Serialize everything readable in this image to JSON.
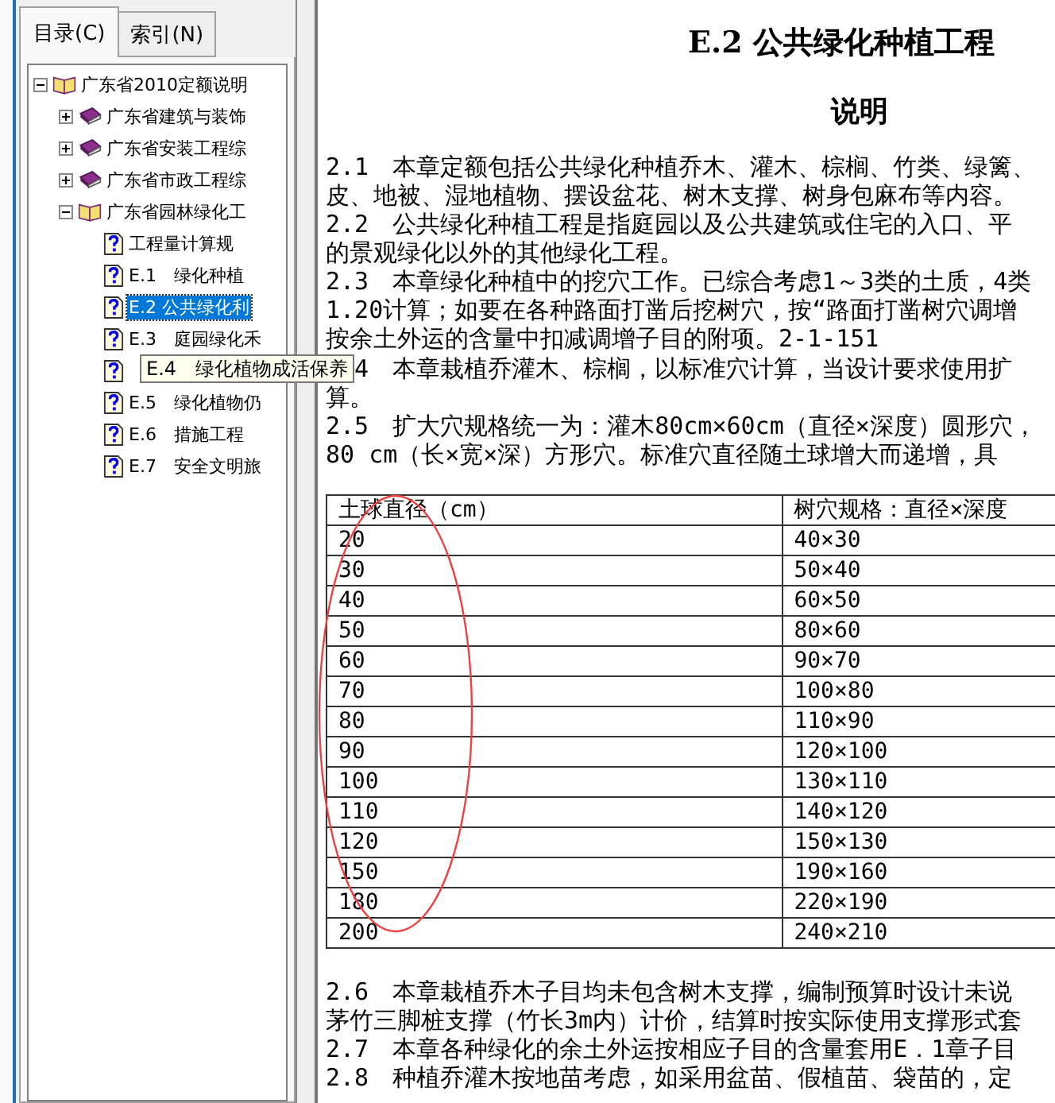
{
  "tabs": [
    {
      "label": "目录(C)",
      "selected": true
    },
    {
      "label": "索引(N)",
      "selected": false
    }
  ],
  "tree": [
    {
      "label": "广东省2010定额说明",
      "kind": "open-book",
      "expanded": true,
      "selected": false,
      "children": [
        {
          "label": "广东省建筑与装饰",
          "kind": "book",
          "expanded": false,
          "selected": false
        },
        {
          "label": "广东省安装工程综",
          "kind": "book",
          "expanded": false,
          "selected": false
        },
        {
          "label": "广东省市政工程综",
          "kind": "book",
          "expanded": false,
          "selected": false
        },
        {
          "label": "广东省园林绿化工",
          "kind": "open-book",
          "expanded": true,
          "selected": false,
          "children": [
            {
              "label": "工程量计算规",
              "kind": "page",
              "selected": false
            },
            {
              "label": "E.1　绿化种植",
              "kind": "page",
              "selected": false
            },
            {
              "label": "E.2 公共绿化利",
              "kind": "page",
              "selected": true
            },
            {
              "label": "E.3　庭园绿化禾",
              "kind": "page",
              "selected": false
            },
            {
              "kind": "page",
              "selected": false
            },
            {
              "label": "E.5　绿化植物仍",
              "kind": "page",
              "selected": false
            },
            {
              "label": "E.6　措施工程",
              "kind": "page",
              "selected": false
            },
            {
              "label": "E.7　安全文明旅",
              "kind": "page",
              "selected": false
            }
          ]
        }
      ]
    }
  ],
  "tooltip": "E.4　绿化植物成活保养",
  "document": {
    "title": "E.2 公共绿化种植工程",
    "subtitle": "说明",
    "lines_before": [
      {
        "kind": "line",
        "text": "2.1　本章定额包括公共绿化种植乔木、灌木、棕榈、竹类、绿篱、"
      },
      {
        "kind": "line",
        "text": "皮、地被、湿地植物、摆设盆花、树木支撑、树身包麻布等内容。"
      },
      {
        "kind": "line",
        "text": "2.2　公共绿化种植工程是指庭园以及公共建筑或住宅的入口、平"
      },
      {
        "kind": "line",
        "text": "的景观绿化以外的其他绿化工程。"
      },
      {
        "kind": "line",
        "text": "2.3　本章绿化种植中的挖穴工作。已综合考虑1～3类的土质，4类"
      },
      {
        "kind": "line",
        "text": "1.20计算；如要在各种路面打凿后挖树穴，按“路面打凿树穴调增"
      },
      {
        "kind": "line",
        "text": "按余土外运的含量中扣减调增子目的附项。2-1-151"
      },
      {
        "kind": "covered",
        "text": "4　本章栽植乔灌木、棕榈，以标准穴计算，当设计要求使用扩"
      },
      {
        "kind": "line",
        "text": "算。"
      },
      {
        "kind": "line",
        "text": "2.5　扩大穴规格统一为：灌木80cm×60cm（直径×深度）圆形穴，"
      },
      {
        "kind": "line",
        "text": "80 cm（长×宽×深）方形穴。标准穴直径随土球增大而递增，具"
      }
    ],
    "table": {
      "columns": [
        "土球直径（cm）",
        "树穴规格：直径×深度"
      ],
      "rows": [
        [
          "20",
          "40×30"
        ],
        [
          "30",
          "50×40"
        ],
        [
          "40",
          "60×50"
        ],
        [
          "50",
          "80×60"
        ],
        [
          "60",
          "90×70"
        ],
        [
          "70",
          "100×80"
        ],
        [
          "80",
          "110×90"
        ],
        [
          "90",
          "120×100"
        ],
        [
          "100",
          "130×110"
        ],
        [
          "110",
          "140×120"
        ],
        [
          "120",
          "150×130"
        ],
        [
          "150",
          "190×160"
        ],
        [
          "180",
          "220×190"
        ],
        [
          "200",
          "240×210"
        ]
      ]
    },
    "lines_after": [
      {
        "kind": "line",
        "text": "2.6　本章栽植乔木子目均未包含树木支撑，编制预算时设计未说"
      },
      {
        "kind": "line",
        "text": "茅竹三脚桩支撑（竹长3m内）计价，结算时按实际使用支撑形式套"
      },
      {
        "kind": "line",
        "text": "2.7　本章各种绿化的余土外运按相应子目的含量套用E．1章子目"
      },
      {
        "kind": "line",
        "text": "2.8　种植乔灌木按地苗考虑，如采用盆苗、假植苗、袋苗的，定"
      }
    ]
  }
}
